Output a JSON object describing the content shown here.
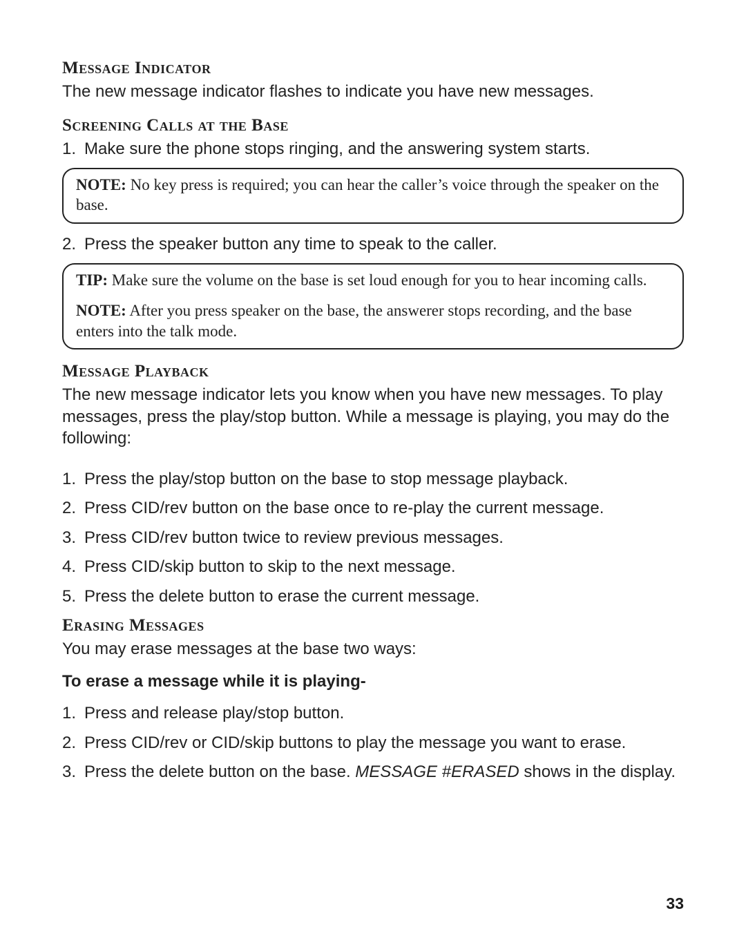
{
  "section1": {
    "heading": "Message Indicator",
    "body": "The new message indicator flashes to indicate you have new messages."
  },
  "section2": {
    "heading": "Screening Calls at the Base",
    "items": [
      "Make sure the phone stops ringing, and the answering system starts.",
      "Press the speaker button any time to speak to the caller."
    ],
    "note1_label": "NOTE:",
    "note1_text": " No key press is required; you can hear the caller’s voice through the speaker on the base.",
    "tip_label": "TIP:",
    "tip_text": " Make sure the volume on the base is set loud enough for you to hear incoming calls.",
    "note2_label": "NOTE:",
    "note2_text": " After you press speaker on the base, the answerer stops recording, and the base enters into the talk mode."
  },
  "section3": {
    "heading": "Message Playback",
    "body": "The new message indicator lets you know when you have new messages. To play messages, press the play/stop button. While a message is playing, you may do the following:",
    "items": [
      "Press the play/stop button on the base to stop message playback.",
      "Press CID/rev button on the base once to re-play the current message.",
      "Press CID/rev button twice to review previous messages.",
      "Press CID/skip button to skip to the next message.",
      "Press the delete button to erase the current message."
    ]
  },
  "section4": {
    "heading": "Erasing Messages",
    "body": "You may erase messages at the base two ways:",
    "subheading": "To erase a message while it is playing-",
    "items": [
      "Press and release play/stop button.",
      "Press CID/rev or CID/skip buttons to play the message you want to erase."
    ],
    "item3_pre": "Press the delete button on the base. ",
    "item3_italic": "MESSAGE #ERASED",
    "item3_post": " shows in the display."
  },
  "page_number": "33"
}
